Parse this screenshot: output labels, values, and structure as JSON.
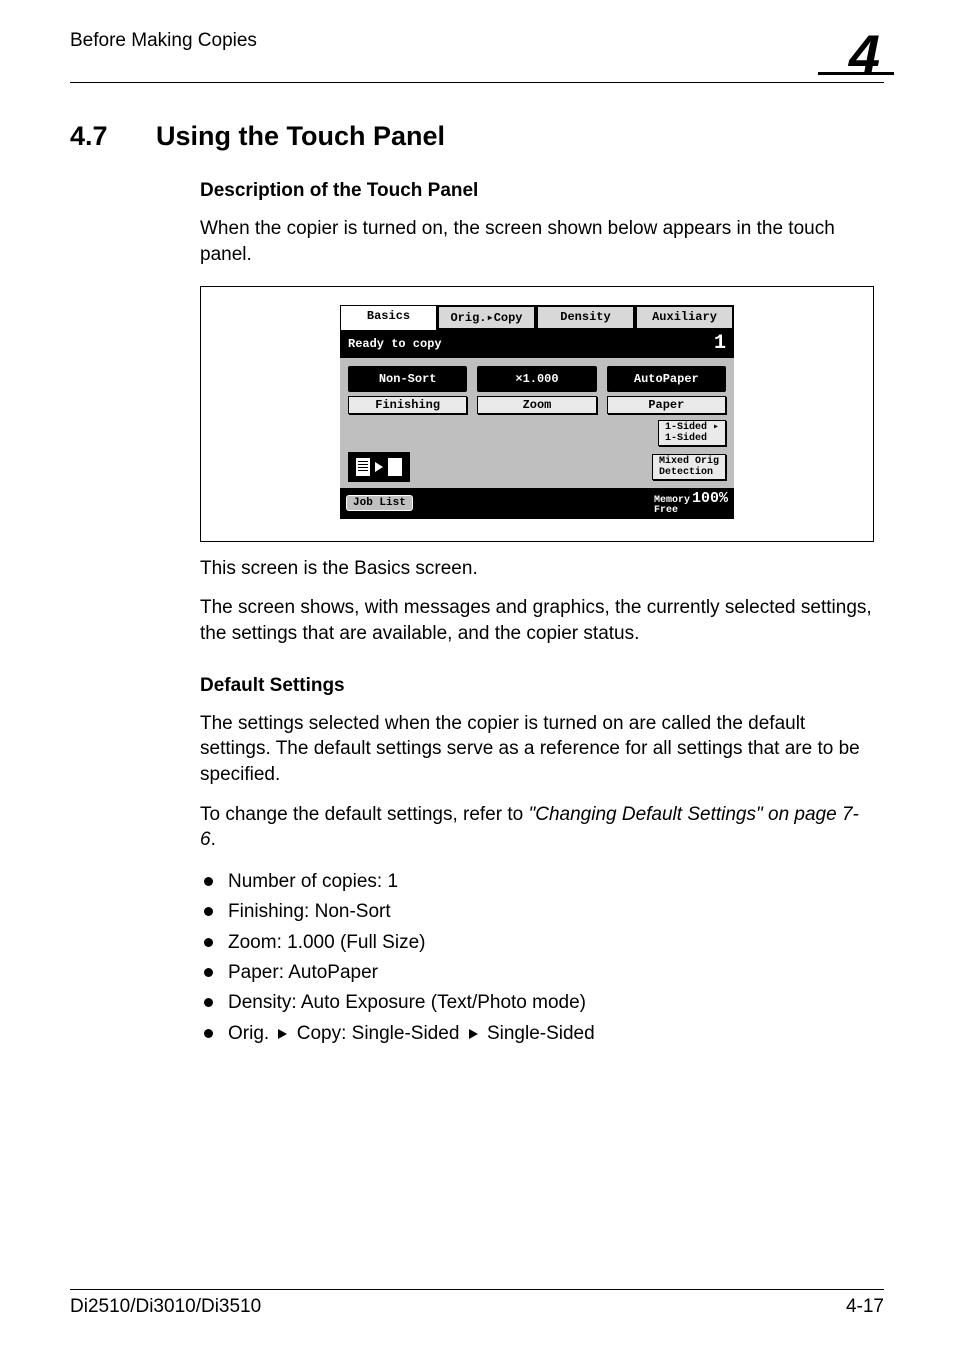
{
  "header": {
    "running_title": "Before Making Copies",
    "chapter_number": "4"
  },
  "section": {
    "number": "4.7",
    "title": "Using the Touch Panel"
  },
  "subsections": {
    "desc_title": "Description of the Touch Panel",
    "desc_para": "When the copier is turned on, the screen shown below appears in the touch panel.",
    "basics_para": "This screen is the Basics screen.",
    "shows_para": "The screen shows, with messages and graphics, the currently selected settings, the settings that are available, and the copier status.",
    "defaults_title": "Default Settings",
    "defaults_para1": "The settings selected when the copier is turned on are called the default settings. The default settings serve as a reference for all settings that are to be specified.",
    "defaults_para2_a": "To change the default settings, refer to ",
    "defaults_para2_ref": "\"Changing Default Settings\" on page 7-6",
    "defaults_para2_b": "."
  },
  "bullets": {
    "b1": "Number of copies: 1",
    "b2": "Finishing: Non-Sort",
    "b3": "Zoom: 1.000 (Full Size)",
    "b4": "Paper: AutoPaper",
    "b5": "Density: Auto Exposure (Text/Photo mode)",
    "b6_a": "Orig. ",
    "b6_b": " Copy: Single-Sided ",
    "b6_c": " Single-Sided"
  },
  "touch_panel": {
    "tabs": {
      "basics": "Basics",
      "orig_copy": "Orig.▸Copy",
      "density": "Density",
      "auxiliary": "Auxiliary"
    },
    "status_msg": "Ready to copy",
    "count": "1",
    "row1": {
      "nonsort": "Non-Sort",
      "zoomval": "×1.000",
      "autopaper": "AutoPaper"
    },
    "row1_labels": {
      "finishing": "Finishing",
      "zoom": "Zoom",
      "paper": "Paper"
    },
    "sided": "1-Sided ▸\n1-Sided",
    "mixed": "Mixed Orig\nDetection",
    "joblist": "Job List",
    "memory_label1": "Memory",
    "memory_label2": "Free",
    "memory_value": "100%"
  },
  "footer": {
    "model": "Di2510/Di3010/Di3510",
    "pagenum": "4-17"
  }
}
